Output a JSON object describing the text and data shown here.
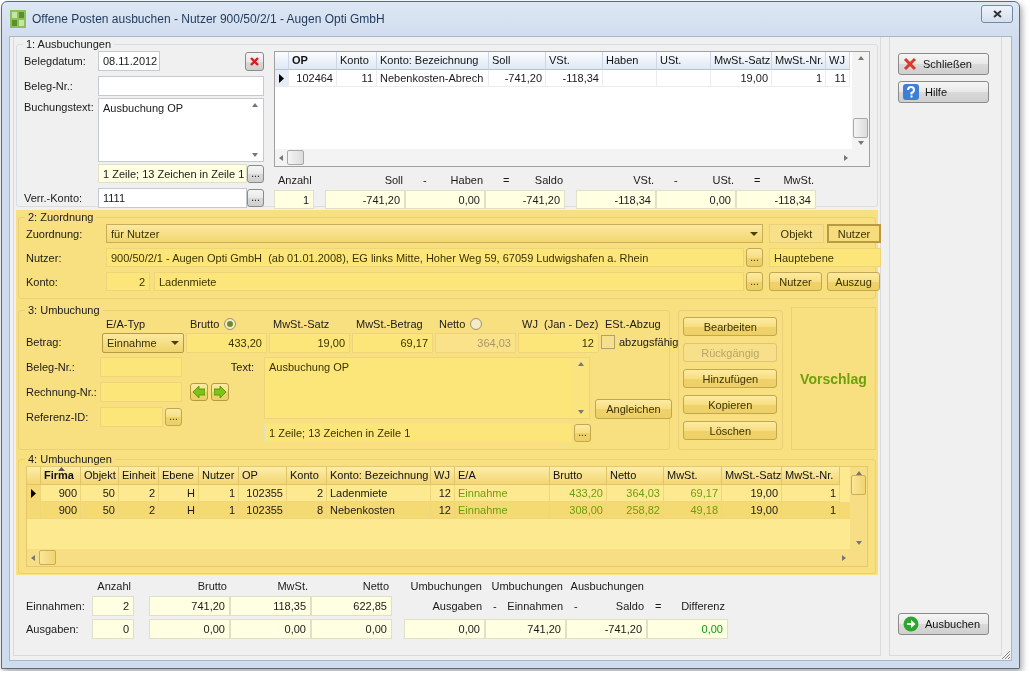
{
  "window": {
    "title": "Offene Posten ausbuchen - Nutzer 900/50/2/1 - Augen Opti GmbH"
  },
  "ausbuchungen": {
    "title": "1: Ausbuchungen",
    "belegdatum": {
      "label": "Belegdatum:",
      "value": "08.11.2012"
    },
    "beleg_nr": {
      "label": "Beleg-Nr.:"
    },
    "buchungstext": {
      "label": "Buchungstext:",
      "value": "Ausbuchung OP",
      "info": "1 Zeile; 13 Zeichen in Zeile 1",
      "info_button": "..."
    },
    "verr_konto": {
      "label": "Verr.-Konto:",
      "value": "1111",
      "button": "..."
    },
    "table": {
      "columns": [
        {
          "label": "OP",
          "kind": "number",
          "sorted": true
        },
        {
          "label": "Konto",
          "kind": "number",
          "sorted": false
        },
        {
          "label": "Konto: Bezeichnung",
          "kind": "text",
          "sorted": false
        },
        {
          "label": "Soll",
          "kind": "number",
          "sorted": false
        },
        {
          "label": "VSt.",
          "kind": "number",
          "sorted": false
        },
        {
          "label": "Haben",
          "kind": "number",
          "sorted": false
        },
        {
          "label": "USt.",
          "kind": "number",
          "sorted": false
        },
        {
          "label": "MwSt.-Satz",
          "kind": "number",
          "sorted": false
        },
        {
          "label": "MwSt.-Nr.",
          "kind": "number",
          "sorted": false
        },
        {
          "label": "WJ",
          "kind": "number",
          "sorted": false
        }
      ],
      "rows": [
        {
          "selected": true,
          "cells": [
            "102464",
            "11",
            "Nebenkosten-Abrech",
            "-741,20",
            "-118,34",
            null,
            null,
            "19,00",
            "1",
            "11"
          ]
        }
      ]
    },
    "summary": [
      [
        {
          "label": "Anzahl",
          "value": "1"
        }
      ],
      [
        {
          "label": "Soll",
          "value": "-741,20"
        },
        {
          "op": "-",
          "label": "Haben",
          "value": "0,00"
        },
        {
          "op": "=",
          "label": "Saldo",
          "value": "-741,20"
        }
      ],
      [
        {
          "label": "VSt.",
          "value": "-118,34"
        },
        {
          "op": "-",
          "label": "USt.",
          "value": "0,00"
        },
        {
          "op": "=",
          "label": "MwSt.",
          "value": "-118,34"
        }
      ]
    ]
  },
  "zuordnung": {
    "title": "2: Zuordnung",
    "zuordnung": {
      "label": "Zuordnung:",
      "value": "für Nutzer"
    },
    "toggle": [
      {
        "label": "Objekt",
        "selected": false
      },
      {
        "label": "Nutzer",
        "selected": true
      }
    ],
    "nutzer": {
      "label": "Nutzer:",
      "value": "900/50/2/1 - Augen Opti GmbH  (ab 01.01.2008), EG links Mitte, Hoher Weg 59, 67059 Ludwigshafen a. Rhein",
      "button": "...",
      "ebene": "Hauptebene"
    },
    "konto": {
      "label": "Konto:",
      "number": "2",
      "name": "Ladenmiete",
      "button": "...",
      "actions": [
        "Nutzer",
        "Auszug"
      ]
    }
  },
  "umbuchung": {
    "title": "3: Umbuchung",
    "headers": [
      {
        "label": "E/A-Typ",
        "kind": "plain"
      },
      {
        "label": "Brutto",
        "kind": "radio",
        "selected": true
      },
      {
        "label": "MwSt.-Satz",
        "kind": "plain"
      },
      {
        "label": "MwSt.-Betrag",
        "kind": "plain"
      },
      {
        "label": "Netto",
        "kind": "radio",
        "selected": false
      },
      {
        "label": "WJ  (Jan - Dez)",
        "kind": "plain"
      },
      {
        "label": "ESt.-Abzug",
        "kind": "plain"
      }
    ],
    "betrag": {
      "label": "Betrag:",
      "type": "Einnahme",
      "values": [
        {
          "value": "433,20",
          "disabled": false
        },
        {
          "value": "19,00",
          "disabled": false
        },
        {
          "value": "69,17",
          "disabled": false
        },
        {
          "value": "364,03",
          "disabled": true
        },
        {
          "value": "12",
          "disabled": false
        }
      ],
      "abzug": {
        "label": "abzugsfähig",
        "checked": false
      }
    },
    "fields": [
      {
        "label": "Beleg-Nr.:"
      },
      {
        "label": "Rechnung-Nr.:"
      },
      {
        "label": "Referenz-ID:",
        "button": "..."
      }
    ],
    "text": {
      "label": "Text:",
      "value": "Ausbuchung OP",
      "info": "1 Zeile; 13 Zeichen in Zeile 1",
      "info_button": "...",
      "action": "Angleichen"
    },
    "actions": [
      {
        "label": "Bearbeiten",
        "disabled": false
      },
      {
        "label": "Rückgängig",
        "disabled": true
      },
      {
        "label": "Hinzufügen",
        "disabled": false
      },
      {
        "label": "Kopieren",
        "disabled": false
      },
      {
        "label": "Löschen",
        "disabled": false
      }
    ],
    "vorschlag": "Vorschlag"
  },
  "umbuchungen": {
    "title": "4: Umbuchungen",
    "table": {
      "columns": [
        {
          "label": "Firma",
          "kind": "number",
          "sorted": true,
          "sort_arrow": true
        },
        {
          "label": "Objekt",
          "kind": "number",
          "sorted": false
        },
        {
          "label": "Einheit",
          "kind": "number",
          "sorted": false
        },
        {
          "label": "Ebene",
          "kind": "number",
          "sorted": false
        },
        {
          "label": "Nutzer",
          "kind": "number",
          "sorted": false
        },
        {
          "label": "OP",
          "kind": "number",
          "sorted": false
        },
        {
          "label": "Konto",
          "kind": "number",
          "sorted": false
        },
        {
          "label": "Konto: Bezeichnung",
          "kind": "text",
          "sorted": false
        },
        {
          "label": "WJ",
          "kind": "number",
          "sorted": false
        },
        {
          "label": "E/A",
          "kind": "text",
          "sorted": false,
          "highlight": true
        },
        {
          "label": "Brutto",
          "kind": "number",
          "sorted": false,
          "highlight": true
        },
        {
          "label": "Netto",
          "kind": "number",
          "sorted": false,
          "highlight": true
        },
        {
          "label": "MwSt.",
          "kind": "number",
          "sorted": false,
          "highlight": true
        },
        {
          "label": "MwSt.-Satz",
          "kind": "number",
          "sorted": false,
          "highlight": false
        },
        {
          "label": "MwSt.-Nr.",
          "kind": "number",
          "sorted": false,
          "highlight": false
        }
      ],
      "rows": [
        {
          "selected": true,
          "cells": [
            "900",
            "50",
            "2",
            "H",
            "1",
            "102355",
            "2",
            "Ladenmiete",
            "12",
            "Einnahme",
            "433,20",
            "364,03",
            "69,17",
            "19,00",
            "1"
          ]
        },
        {
          "selected": false,
          "cells": [
            "900",
            "50",
            "2",
            "H",
            "1",
            "102355",
            "8",
            "Nebenkosten",
            "12",
            "Einnahme",
            "308,00",
            "258,82",
            "49,18",
            "19,00",
            "1"
          ]
        }
      ]
    }
  },
  "totals": {
    "left_headers": [
      "Anzahl",
      "Brutto",
      "MwSt.",
      "Netto"
    ],
    "right_headers": [
      {
        "top": "Umbuchungen",
        "bottom": "Ausgaben"
      },
      {
        "top": "Umbuchungen",
        "op": "-",
        "bottom": "Einnahmen"
      },
      {
        "top": "Ausbuchungen",
        "op": "-",
        "bottom": "Saldo"
      },
      {
        "op": "=",
        "bottom": "Differenz"
      }
    ],
    "einnahmen": {
      "label": "Einnahmen:",
      "values": [
        "2",
        "741,20",
        "118,35",
        "622,85"
      ]
    },
    "ausgaben": {
      "label": "Ausgaben:",
      "values": [
        "0",
        "0,00",
        "0,00",
        "0,00"
      ]
    },
    "results": [
      {
        "value": "0,00",
        "kind": "amount"
      },
      {
        "value": "741,20",
        "kind": "amount"
      },
      {
        "value": "-741,20",
        "kind": "amount"
      },
      {
        "value": "0,00",
        "kind": "difference"
      }
    ]
  },
  "close_button": "Schließen",
  "help_button": "Hilfe",
  "submit_button": "Ausbuchen"
}
